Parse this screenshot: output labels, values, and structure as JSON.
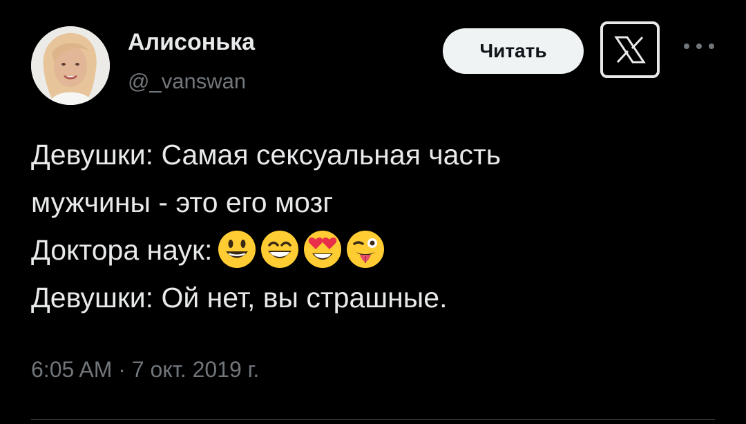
{
  "author": {
    "display_name": "Алисонька",
    "handle": "@_vanswan"
  },
  "actions": {
    "follow_label": "Читать",
    "logo_icon": "x-logo-icon",
    "more_icon": "more-options-icon"
  },
  "tweet": {
    "lines": [
      "Девушки: Самая сексуальная часть",
      "мужчины - это его мозг",
      "Доктора наук:",
      "Девушки: Ой нет, вы страшные."
    ],
    "emojis": [
      "smiley-emoji",
      "grin-emoji",
      "heart-eyes-emoji",
      "winking-tongue-emoji"
    ]
  },
  "timestamp": "6:05 AM · 7 окт. 2019 г.",
  "colors": {
    "background": "#000000",
    "text": "#e7e9ea",
    "secondary": "#71767b",
    "button_bg": "#eff3f4",
    "emoji_yellow": "#ffcc33"
  }
}
